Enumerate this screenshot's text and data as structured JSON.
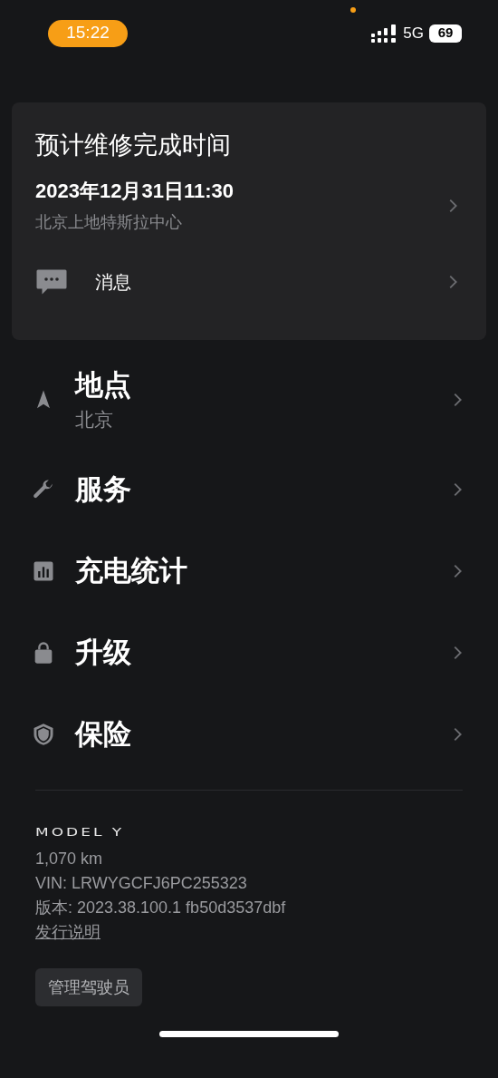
{
  "status_bar": {
    "time": "15:22",
    "network": "5G",
    "battery": "69"
  },
  "repair_card": {
    "title": "预计维修完成时间",
    "datetime": "2023年12月31日11:30",
    "location": "北京上地特斯拉中心",
    "message_label": "消息"
  },
  "menu": [
    {
      "kind": "location",
      "label": "地点",
      "subtitle": "北京"
    },
    {
      "kind": "service",
      "label": "服务"
    },
    {
      "kind": "charging",
      "label": "充电统计"
    },
    {
      "kind": "upgrade",
      "label": "升级"
    },
    {
      "kind": "insurance",
      "label": "保险"
    }
  ],
  "vehicle": {
    "model": "MODEL Y",
    "odometer": "1,070 km",
    "vin": "VIN: LRWYGCFJ6PC255323",
    "version": "版本: 2023.38.100.1 fb50d3537dbf",
    "release_notes": "发行说明",
    "manage_drivers": "管理驾驶员"
  }
}
